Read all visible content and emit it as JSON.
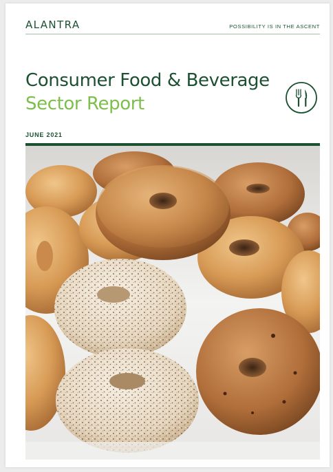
{
  "header": {
    "brand": "ALANTRA",
    "tagline": "POSSIBILITY IS IN THE ASCENT"
  },
  "cover": {
    "title_line1": "Consumer Food & Beverage",
    "title_line2": "Sector Report",
    "date": "JUNE 2021",
    "sector_icon": "fork-knife-icon",
    "image_subject": "bagels-photo"
  },
  "colors": {
    "brand_dark_green": "#1b5130",
    "accent_light_green": "#7cbf4a",
    "divider_green": "#9fc0a8"
  }
}
